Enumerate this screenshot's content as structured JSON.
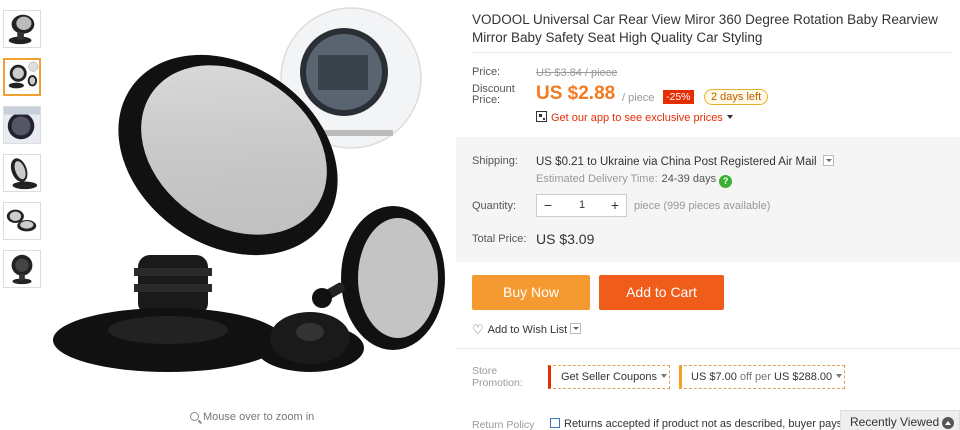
{
  "product": {
    "title": "VODOOL Universal Car Rear View Miror 360 Degree Rotation Baby Rearview Mirror Baby Safety Seat High Quality Car Styling",
    "zoom_hint": "Mouse over to zoom in"
  },
  "price": {
    "price_label": "Price:",
    "original": "US $3.84 / piece",
    "discount_label_1": "Discount",
    "discount_label_2": "Price:",
    "current": "US $2.88",
    "per_unit": "/ piece",
    "discount_pct": "-25%",
    "time_left": "2 days left",
    "app_promo": "Get our app to see exclusive prices"
  },
  "shipping": {
    "label": "Shipping:",
    "cost": "US $0.21",
    "route": "to Ukraine via China Post Registered Air Mail",
    "delivery_label": "Estimated Delivery Time:",
    "delivery_time": "24-39 days"
  },
  "quantity": {
    "label": "Quantity:",
    "minus": "−",
    "value": "1",
    "plus": "+",
    "availability": "piece (999 pieces available)"
  },
  "total": {
    "label": "Total Price:",
    "value": "US $3.09"
  },
  "actions": {
    "buy_now": "Buy Now",
    "add_to_cart": "Add to Cart",
    "wishlist": "Add to Wish List"
  },
  "promotion": {
    "label_1": "Store",
    "label_2": "Promotion:",
    "seller_coupons": "Get Seller Coupons",
    "deal_amount": "US $7.00",
    "deal_off": "off per",
    "deal_threshold": "US $288.00"
  },
  "returns": {
    "label": "Return Policy",
    "text": "Returns accepted if product not as described, buyer pays"
  },
  "recently_viewed": "Recently Viewed",
  "colors": {
    "accent_price": "#f47a20",
    "buy_now": "#f59a31",
    "add_to_cart": "#f05c1a",
    "discount_badge": "#e62e04"
  }
}
